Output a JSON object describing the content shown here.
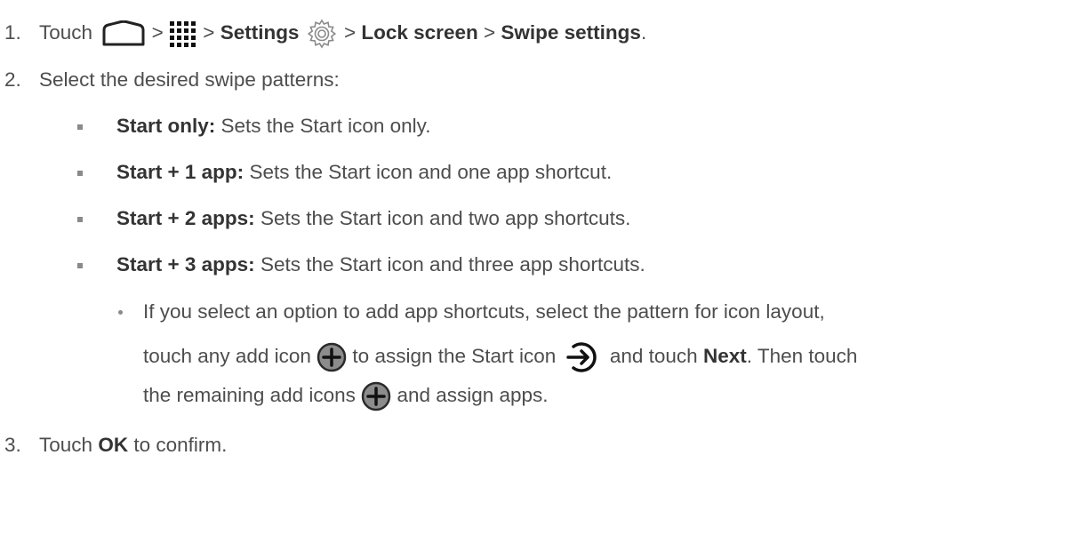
{
  "steps": [
    {
      "num": "1.",
      "touch": "Touch",
      "gt1": ">",
      "gt2": ">",
      "settings": "Settings",
      "gt3": ">",
      "lock_screen": "Lock screen",
      "gt4": ">",
      "swipe_settings": "Swipe settings",
      "end": "."
    },
    {
      "num": "2.",
      "text": "Select the desired swipe patterns:"
    },
    {
      "num": "3.",
      "touch": "Touch",
      "ok": "OK",
      "rest": "to confirm."
    }
  ],
  "options": [
    {
      "label": "Start only:",
      "desc": "Sets the Start icon only."
    },
    {
      "label": "Start + 1 app:",
      "desc": "Sets the Start icon and one app shortcut."
    },
    {
      "label": "Start + 2 apps:",
      "desc": "Sets the Start icon and two app shortcuts."
    },
    {
      "label": "Start + 3 apps:",
      "desc": "Sets the Start icon and three app shortcuts."
    }
  ],
  "subnote": {
    "line1": "If you select an option to add app shortcuts, select the pattern for icon layout,",
    "l2a": "touch any add icon",
    "l2b": "to assign the Start icon",
    "l2c": "and touch",
    "next": "Next",
    "l2d": ". Then touch",
    "l3a": "the remaining add icons",
    "l3b": "and assign apps."
  },
  "icons": {
    "home": "home-icon",
    "apps": "apps-grid-icon",
    "settings": "settings-gear-icon",
    "add": "add-icon",
    "start": "start-arrow-icon"
  }
}
